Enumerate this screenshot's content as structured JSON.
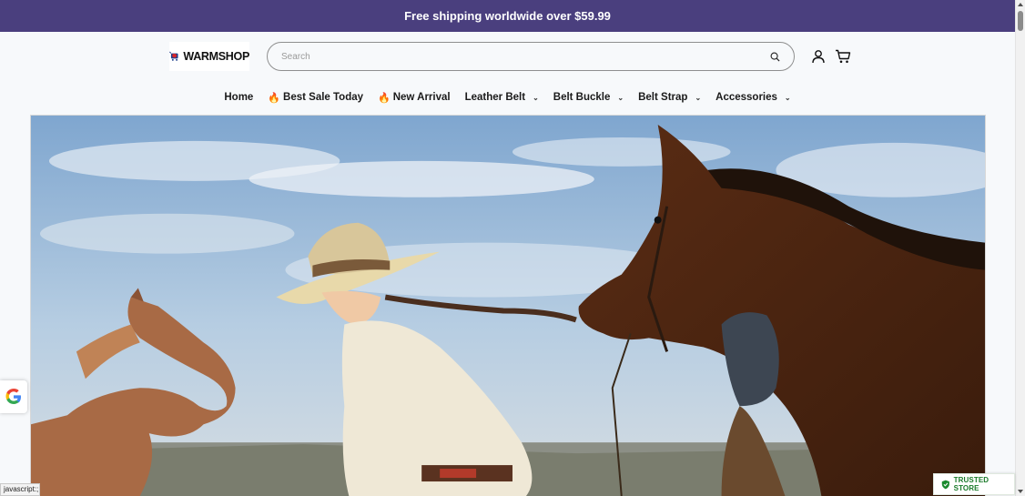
{
  "announcement": "Free shipping worldwide over $59.99",
  "logo": {
    "text": "WARMSHOP",
    "icon": "cart-logo-icon"
  },
  "search": {
    "placeholder": "Search",
    "icon": "search-icon"
  },
  "header_icons": {
    "account": "user-icon",
    "cart": "cart-icon"
  },
  "nav": {
    "home": "Home",
    "best_sale": "Best Sale Today",
    "new_arrival": "New Arrival",
    "leather_belt": "Leather Belt",
    "belt_buckle": "Belt Buckle",
    "belt_strap": "Belt Strap",
    "accessories": "Accessories"
  },
  "hero": {
    "alt": "hero-banner-image"
  },
  "google_badge": "google-icon",
  "trusted_badge": "TRUSTED STORE",
  "status_bar": "javascript:;",
  "colors": {
    "announcement_bg": "#4a3f7e",
    "trusted_green": "#1a7a2a",
    "fire": "#f07b24"
  }
}
